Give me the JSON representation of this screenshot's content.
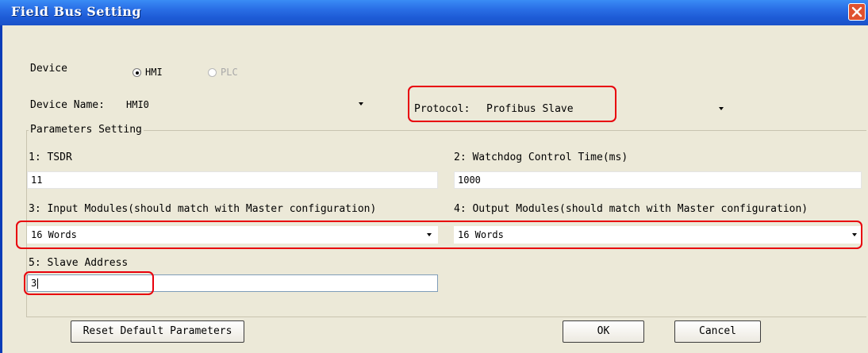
{
  "window": {
    "title": "Field Bus Setting"
  },
  "device": {
    "label": "Device",
    "options": [
      {
        "label": "HMI",
        "selected": true,
        "enabled": true
      },
      {
        "label": "PLC",
        "selected": false,
        "enabled": false
      }
    ]
  },
  "device_name": {
    "label": "Device Name:",
    "value": "HMI0"
  },
  "protocol": {
    "label": "Protocol:",
    "value": "Profibus Slave"
  },
  "parameters": {
    "group_label": "Parameters Setting",
    "tsdr": {
      "label": "1: TSDR",
      "value": "11"
    },
    "watchdog": {
      "label": "2: Watchdog Control Time(ms)",
      "value": "1000"
    },
    "input_modules": {
      "label": "3: Input Modules(should match with Master configuration)",
      "value": "16 Words"
    },
    "output_modules": {
      "label": "4: Output Modules(should match with Master configuration)",
      "value": "16 Words"
    },
    "slave_address": {
      "label": "5: Slave Address",
      "value": "3"
    }
  },
  "buttons": {
    "reset": "Reset Default Parameters",
    "ok": "OK",
    "cancel": "Cancel"
  },
  "highlight_color": "#e8000b"
}
